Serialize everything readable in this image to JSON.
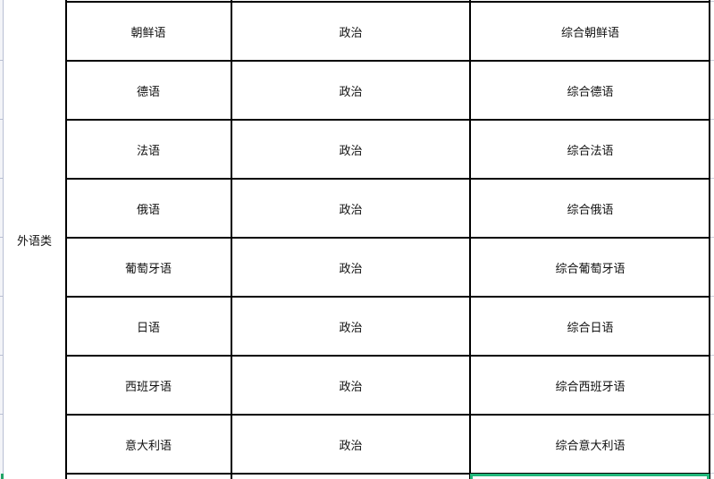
{
  "sheet": {
    "category": "外语类",
    "rows": [
      {
        "language": "朝鲜语",
        "subject": "政治",
        "exam": "综合朝鲜语"
      },
      {
        "language": "德语",
        "subject": "政治",
        "exam": "综合德语"
      },
      {
        "language": "法语",
        "subject": "政治",
        "exam": "综合法语"
      },
      {
        "language": "俄语",
        "subject": "政治",
        "exam": "综合俄语"
      },
      {
        "language": "葡萄牙语",
        "subject": "政治",
        "exam": "综合葡萄牙语"
      },
      {
        "language": "日语",
        "subject": "政治",
        "exam": "综合日语"
      },
      {
        "language": "西班牙语",
        "subject": "政治",
        "exam": "综合西班牙语"
      },
      {
        "language": "意大利语",
        "subject": "政治",
        "exam": "综合意大利语"
      }
    ],
    "selection_color": "#21b77a"
  }
}
